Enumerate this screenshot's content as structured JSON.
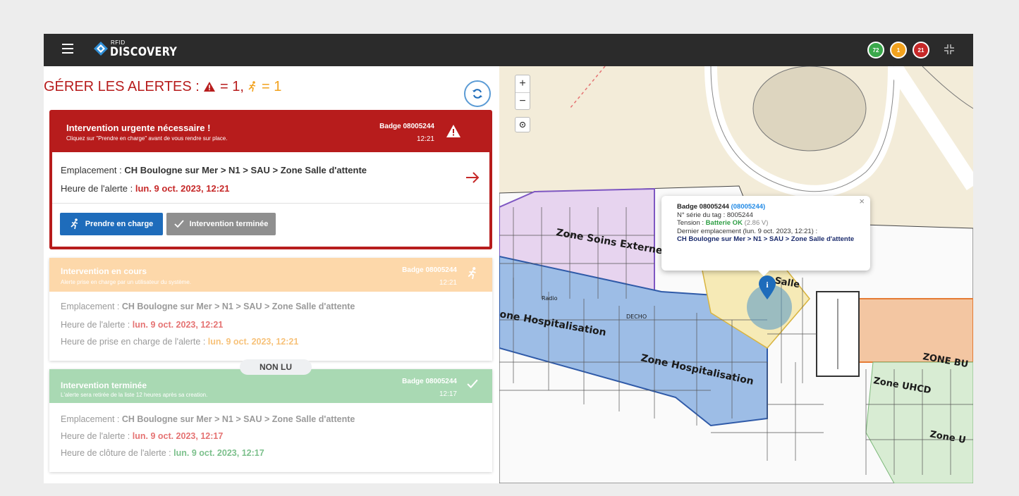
{
  "header": {
    "logo_small": "RFID",
    "logo_big": "DISCOVERY",
    "status_counts": [
      {
        "value": "72",
        "color": "#3aa84b"
      },
      {
        "value": "1",
        "color": "#f2a21e"
      },
      {
        "value": "21",
        "color": "#c62828"
      }
    ]
  },
  "alerts_panel": {
    "title_prefix": "GÉRER LES ALERTES :",
    "title_urgent_count": "= 1,",
    "title_inprogress_count": "= 1",
    "cards": [
      {
        "status": "urgent",
        "title": "Intervention urgente nécessaire !",
        "subtitle": "Cliquez sur \"Prendre en charge\" avant de vous rendre sur place.",
        "badge": "Badge 08005244",
        "time": "12:21",
        "location_label": "Emplacement : ",
        "location_value": "CH Boulogne sur Mer > N1 > SAU > Zone Salle d'attente",
        "alert_time_label": "Heure de l'alerte : ",
        "alert_time_value": "lun. 9 oct. 2023, 12:21",
        "take_button": "Prendre en charge",
        "done_button": "Intervention terminée",
        "color": "#b71c1c"
      },
      {
        "status": "in_progress",
        "title": "Intervention en cours",
        "subtitle": "Alerte prise en charge par un utilisateur du système.",
        "badge": "Badge 08005244",
        "time": "12:21",
        "location_label": "Emplacement : ",
        "location_value": "CH Boulogne sur Mer > N1 > SAU > Zone Salle d'attente",
        "alert_time_label": "Heure de l'alerte : ",
        "alert_time_value": "lun. 9 oct. 2023, 12:21",
        "taken_time_label": "Heure de prise en charge de l'alerte : ",
        "taken_time_value": "lun. 9 oct. 2023, 12:21",
        "color": "#fdd8aa"
      },
      {
        "status": "done",
        "unread_label": "NON LU",
        "title": "Intervention terminée",
        "subtitle": "L'alerte sera retirée de la liste 12 heures après sa creation.",
        "badge": "Badge 08005244",
        "time": "12:17",
        "location_label": "Emplacement : ",
        "location_value": "CH Boulogne sur Mer > N1 > SAU > Zone Salle d'attente",
        "alert_time_label": "Heure de l'alerte : ",
        "alert_time_value": "lun. 9 oct. 2023, 12:17",
        "closed_time_label": "Heure de clôture de l'alerte : ",
        "closed_time_value": "lun. 9 oct. 2023, 12:17",
        "color": "#a9d9b3"
      }
    ]
  },
  "map": {
    "zoom_in": "+",
    "zoom_out": "−",
    "zones": [
      "Zone Soins Externes",
      "one Hospitalisation",
      "Zone Hospitalisation",
      "Salle",
      "ZONE BU",
      "Zone UHCD",
      "Zone U",
      "Radio",
      "DECHO"
    ],
    "popup": {
      "badge": "Badge 08005244",
      "badge_id": "(08005244)",
      "serial_label": "N° série du tag : ",
      "serial_value": "8005244",
      "tension_label": "Tension : ",
      "tension_status": "Batterie OK",
      "tension_value": "(2.86 V)",
      "last_location_label": "Dernier emplacement (lun. 9 oct. 2023, 12:21) :",
      "last_location_value": "CH Boulogne sur Mer > N1 > SAU > Zone Salle d'attente",
      "close": "×"
    }
  }
}
